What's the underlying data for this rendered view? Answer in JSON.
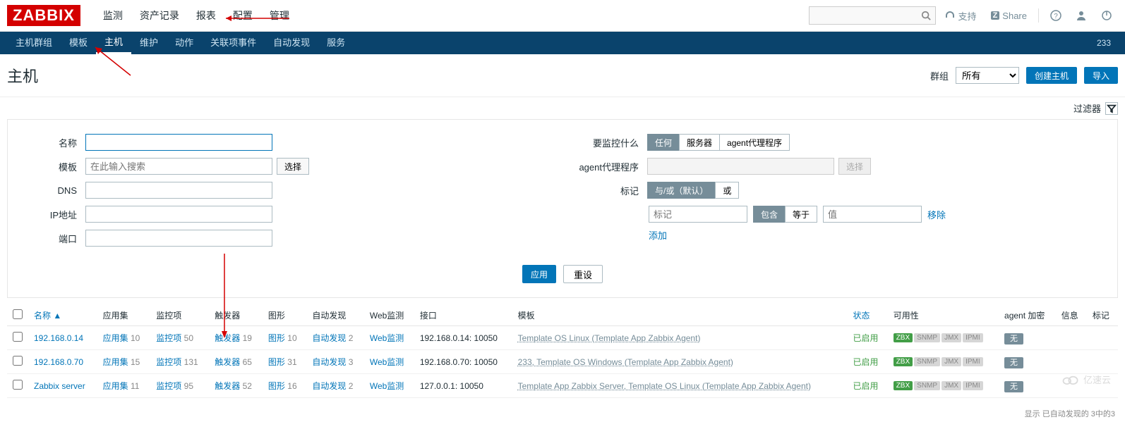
{
  "logo": "ZABBIX",
  "top_nav": [
    "监测",
    "资产记录",
    "报表",
    "配置",
    "管理"
  ],
  "top_nav_active": 3,
  "header_right": {
    "support": "支持",
    "share": "Share"
  },
  "sub_nav": [
    "主机群组",
    "模板",
    "主机",
    "维护",
    "动作",
    "关联项事件",
    "自动发现",
    "服务"
  ],
  "sub_nav_active": 2,
  "sub_nav_right": "233",
  "page_title": "主机",
  "group_label": "群组",
  "group_select": "所有",
  "btn_create": "创建主机",
  "btn_import": "导入",
  "filter_toggle": "过滤器",
  "filter": {
    "name_label": "名称",
    "template_label": "模板",
    "template_placeholder": "在此输入搜索",
    "template_select": "选择",
    "dns_label": "DNS",
    "ip_label": "IP地址",
    "port_label": "端口",
    "monitor_label": "要监控什么",
    "monitor_options": [
      "任何",
      "服务器",
      "agent代理程序"
    ],
    "proxy_label": "agent代理程序",
    "proxy_select": "选择",
    "tag_label": "标记",
    "tag_modes": [
      "与/或（默认）",
      "或"
    ],
    "tag_placeholder": "标记",
    "tag_op_options": [
      "包含",
      "等于"
    ],
    "tag_value_placeholder": "值",
    "tag_remove": "移除",
    "tag_add": "添加",
    "apply": "应用",
    "reset": "重设"
  },
  "columns": {
    "name": "名称",
    "apps": "应用集",
    "items": "监控项",
    "triggers": "触发器",
    "graphs": "图形",
    "discovery": "自动发现",
    "web": "Web监测",
    "interface": "接口",
    "templates": "模板",
    "status": "状态",
    "availability": "可用性",
    "encryption": "agent 加密",
    "info": "信息",
    "tags": "标记"
  },
  "avail_labels": {
    "zbx": "ZBX",
    "snmp": "SNMP",
    "jmx": "JMX",
    "ipmi": "IPMI"
  },
  "enc_none": "无",
  "rows": [
    {
      "name": "192.168.0.14",
      "apps": "应用集",
      "apps_n": "10",
      "items": "监控项",
      "items_n": "50",
      "triggers": "触发器",
      "triggers_n": "19",
      "graphs": "图形",
      "graphs_n": "10",
      "discovery": "自动发现",
      "discovery_n": "2",
      "web": "Web监测",
      "interface": "192.168.0.14: 10050",
      "templates": "Template OS Linux (Template App Zabbix Agent)",
      "status": "已启用"
    },
    {
      "name": "192.168.0.70",
      "apps": "应用集",
      "apps_n": "15",
      "items": "监控项",
      "items_n": "131",
      "triggers": "触发器",
      "triggers_n": "65",
      "graphs": "图形",
      "graphs_n": "31",
      "discovery": "自动发现",
      "discovery_n": "3",
      "web": "Web监测",
      "interface": "192.168.0.70: 10050",
      "templates": "233, Template OS Windows (Template App Zabbix Agent)",
      "status": "已启用"
    },
    {
      "name": "Zabbix server",
      "apps": "应用集",
      "apps_n": "11",
      "items": "监控项",
      "items_n": "95",
      "triggers": "触发器",
      "triggers_n": "52",
      "graphs": "图形",
      "graphs_n": "16",
      "discovery": "自动发现",
      "discovery_n": "2",
      "web": "Web监测",
      "interface": "127.0.0.1: 10050",
      "templates": "Template App Zabbix Server, Template OS Linux (Template App Zabbix Agent)",
      "status": "已启用"
    }
  ],
  "footer_note": "显示 已自动发现的 3中的3",
  "watermark": "亿速云"
}
